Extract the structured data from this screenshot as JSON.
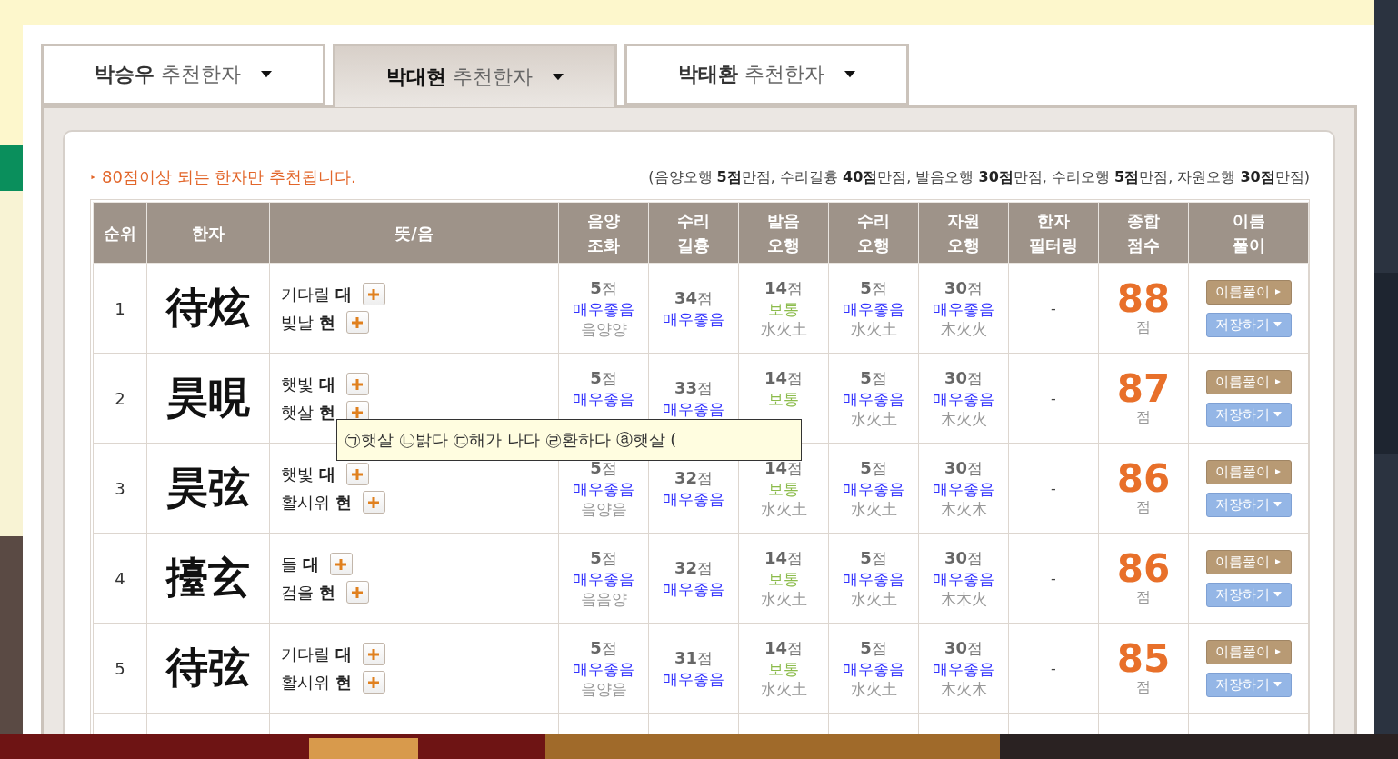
{
  "tabs": [
    {
      "name": "박승우",
      "suffix": "추천한자",
      "selected": false
    },
    {
      "name": "박대현",
      "suffix": "추천한자",
      "selected": true
    },
    {
      "name": "박태환",
      "suffix": "추천한자",
      "selected": false
    }
  ],
  "notice": "80점이상 되는 한자만 추천됩니다.",
  "scoring_note": "(음양오행 **5점**만점, 수리길흉 **40점**만점, 발음오행 **30점**만점, 수리오행 **5점**만점, 자원오행 **30점**만점)",
  "table": {
    "columns": [
      "순위",
      "한자",
      "뜻/음",
      "음양\n조화",
      "수리\n길흉",
      "발음\n오행",
      "수리\n오행",
      "자원\n오행",
      "한자\n필터링",
      "종합\n점수",
      "이름\n풀이"
    ],
    "rows": [
      {
        "rank": "1",
        "hanja": "待炫",
        "meanings": [
          {
            "meaning": "기다릴",
            "sound": "대"
          },
          {
            "meaning": "빛날",
            "sound": "현"
          }
        ],
        "scores": [
          {
            "points": "**5**점",
            "rating": "매우좋음",
            "color": "#3333ff",
            "element": "음양양"
          },
          {
            "points": "**34**점",
            "rating": "매우좋음",
            "color": "#3333ff"
          },
          {
            "points": "**14**점",
            "rating": "보통",
            "color": "#8cbc4c",
            "element": "水火土"
          },
          {
            "points": "**5**점",
            "rating": "매우좋음",
            "color": "#3333ff",
            "element": "水火土"
          },
          {
            "points": "**30**점",
            "rating": "매우좋음",
            "color": "#3333ff",
            "element": "木火火"
          }
        ],
        "filter": "-",
        "total": "88",
        "total_unit": "점",
        "buttons": [
          "이름풀이",
          "저장하기"
        ]
      },
      {
        "rank": "2",
        "hanja": "昊晛",
        "meanings": [
          {
            "meaning": "햇빛",
            "sound": "대"
          },
          {
            "meaning": "햇살",
            "sound": "현"
          }
        ],
        "scores": [
          {
            "points": "**5**점",
            "rating": "매우좋음",
            "color": "#3333ff"
          },
          {
            "points": "**33**점",
            "rating": "매우좋음",
            "color": "#3333ff"
          },
          {
            "points": "**14**점",
            "rating": "보통",
            "color": "#8cbc4c"
          },
          {
            "points": "**5**점",
            "rating": "매우좋음",
            "color": "#3333ff",
            "element": "水火土"
          },
          {
            "points": "**30**점",
            "rating": "매우좋음",
            "color": "#3333ff",
            "element": "木火火"
          }
        ],
        "filter": "-",
        "total": "87",
        "total_unit": "점",
        "buttons": [
          "이름풀이",
          "저장하기"
        ]
      },
      {
        "rank": "3",
        "hanja": "昊弦",
        "meanings": [
          {
            "meaning": "햇빛",
            "sound": "대"
          },
          {
            "meaning": "활시위",
            "sound": "현"
          }
        ],
        "scores": [
          {
            "points": "**5**점",
            "rating": "매우좋음",
            "color": "#3333ff",
            "element": "음양음"
          },
          {
            "points": "**32**점",
            "rating": "매우좋음",
            "color": "#3333ff"
          },
          {
            "points": "**14**점",
            "rating": "보통",
            "color": "#8cbc4c",
            "element": "水火土"
          },
          {
            "points": "**5**점",
            "rating": "매우좋음",
            "color": "#3333ff",
            "element": "水火土"
          },
          {
            "points": "**30**점",
            "rating": "매우좋음",
            "color": "#3333ff",
            "element": "木火木"
          }
        ],
        "filter": "-",
        "total": "86",
        "total_unit": "점",
        "buttons": [
          "이름풀이",
          "저장하기"
        ]
      },
      {
        "rank": "4",
        "hanja": "擡玄",
        "meanings": [
          {
            "meaning": "들",
            "sound": "대"
          },
          {
            "meaning": "검을",
            "sound": "현"
          }
        ],
        "scores": [
          {
            "points": "**5**점",
            "rating": "매우좋음",
            "color": "#3333ff",
            "element": "음음양"
          },
          {
            "points": "**32**점",
            "rating": "매우좋음",
            "color": "#3333ff"
          },
          {
            "points": "**14**점",
            "rating": "보통",
            "color": "#8cbc4c",
            "element": "水火土"
          },
          {
            "points": "**5**점",
            "rating": "매우좋음",
            "color": "#3333ff",
            "element": "水火土"
          },
          {
            "points": "**30**점",
            "rating": "매우좋음",
            "color": "#3333ff",
            "element": "木木火"
          }
        ],
        "filter": "-",
        "total": "86",
        "total_unit": "점",
        "buttons": [
          "이름풀이",
          "저장하기"
        ]
      },
      {
        "rank": "5",
        "hanja": "待弦",
        "meanings": [
          {
            "meaning": "기다릴",
            "sound": "대"
          },
          {
            "meaning": "활시위",
            "sound": "현"
          }
        ],
        "scores": [
          {
            "points": "**5**점",
            "rating": "매우좋음",
            "color": "#3333ff",
            "element": "음양음"
          },
          {
            "points": "**31**점",
            "rating": "매우좋음",
            "color": "#3333ff"
          },
          {
            "points": "**14**점",
            "rating": "보통",
            "color": "#8cbc4c",
            "element": "水火土"
          },
          {
            "points": "**5**점",
            "rating": "매우좋음",
            "color": "#3333ff",
            "element": "水火土"
          },
          {
            "points": "**30**점",
            "rating": "매우좋음",
            "color": "#3333ff",
            "element": "木火木"
          }
        ],
        "filter": "-",
        "total": "85",
        "total_unit": "점",
        "buttons": [
          "이름풀이",
          "저장하기"
        ]
      }
    ]
  },
  "tooltip": "㉠햇살 ㉡밝다 ㉢해가 나다 ㉣환하다 ⓐ햇살 ("
}
